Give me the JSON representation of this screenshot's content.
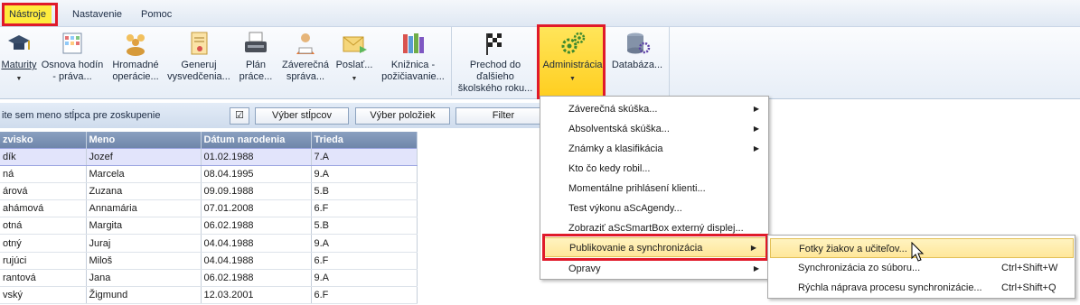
{
  "menubar": {
    "tabs": [
      "Nástroje",
      "Nastavenie",
      "Pomoc"
    ]
  },
  "ribbon": {
    "buttons": [
      {
        "label": "Maturity",
        "icon": "graduation-cap-icon"
      },
      {
        "label": "Osnova hodín - práva...",
        "icon": "calendar-grid-icon"
      },
      {
        "label": "Hromadné operácie...",
        "icon": "group-people-icon"
      },
      {
        "label": "Generuj vysvedčenia...",
        "icon": "certificate-icon"
      },
      {
        "label": "Plán práce...",
        "icon": "typewriter-icon"
      },
      {
        "label": "Záverečná správa...",
        "icon": "person-report-icon"
      },
      {
        "label": "Poslať...",
        "icon": "envelope-icon"
      },
      {
        "label": "Knižnica - požičiavanie...",
        "icon": "books-icon"
      },
      {
        "label": "Prechod do ďalšieho školského roku...",
        "icon": "checkered-flag-icon"
      },
      {
        "label": "Administrácia",
        "icon": "gears-icon"
      },
      {
        "label": "Databáza...",
        "icon": "database-icon"
      }
    ]
  },
  "toolbar": {
    "group_hint": "ite sem meno stĺpca pre zoskupenie",
    "check_symbol": "☑",
    "columns_button": "Výber stĺpcov",
    "items_button": "Výber položiek",
    "filter_button": "Filter"
  },
  "grid": {
    "headers": [
      "zvisko",
      "Meno",
      "Dátum narodenia",
      "Trieda"
    ],
    "rows": [
      [
        "dík",
        "Jozef",
        "01.02.1988",
        "7.A"
      ],
      [
        "ná",
        "Marcela",
        "08.04.1995",
        "9.A"
      ],
      [
        "árová",
        "Zuzana",
        "09.09.1988",
        "5.B"
      ],
      [
        "ahámová",
        "Annamária",
        "07.01.2008",
        "6.F"
      ],
      [
        "otná",
        "Margita",
        "06.02.1988",
        "5.B"
      ],
      [
        "otný",
        "Juraj",
        "04.04.1988",
        "9.A"
      ],
      [
        "rujúci",
        "Miloš",
        "04.04.1988",
        "6.F"
      ],
      [
        "rantová",
        "Jana",
        "06.02.1988",
        "9.A"
      ],
      [
        "vský",
        "Žigmund",
        "12.03.2001",
        "6.F"
      ]
    ]
  },
  "admin_menu": {
    "items": [
      {
        "label": "Záverečná skúška...",
        "submenu": true
      },
      {
        "label": "Absolventská skúška...",
        "submenu": true
      },
      {
        "label": "Známky a klasifikácia",
        "submenu": true
      },
      {
        "label": "Kto čo kedy robil...",
        "submenu": false
      },
      {
        "label": "Momentálne prihlásení klienti...",
        "submenu": false
      },
      {
        "label": "Test výkonu aScAgendy...",
        "submenu": false
      },
      {
        "label": "Zobraziť aScSmartBox externý displej...",
        "submenu": false
      },
      {
        "label": "Publikovanie a synchronizácia",
        "submenu": true
      },
      {
        "label": "Opravy",
        "submenu": true
      }
    ]
  },
  "publish_menu": {
    "items": [
      {
        "label": "Fotky žiakov a učiteľov...",
        "shortcut": ""
      },
      {
        "label": "Synchronizácia zo súboru...",
        "shortcut": "Ctrl+Shift+W"
      },
      {
        "label": "Rýchla náprava procesu synchronizácie...",
        "shortcut": "Ctrl+Shift+Q"
      }
    ]
  },
  "colors": {
    "highlight": "#ffe79a",
    "annotation_red": "#e01a2a",
    "grid_header": "#7d93b6",
    "selected_row": "#e2e4fb"
  }
}
